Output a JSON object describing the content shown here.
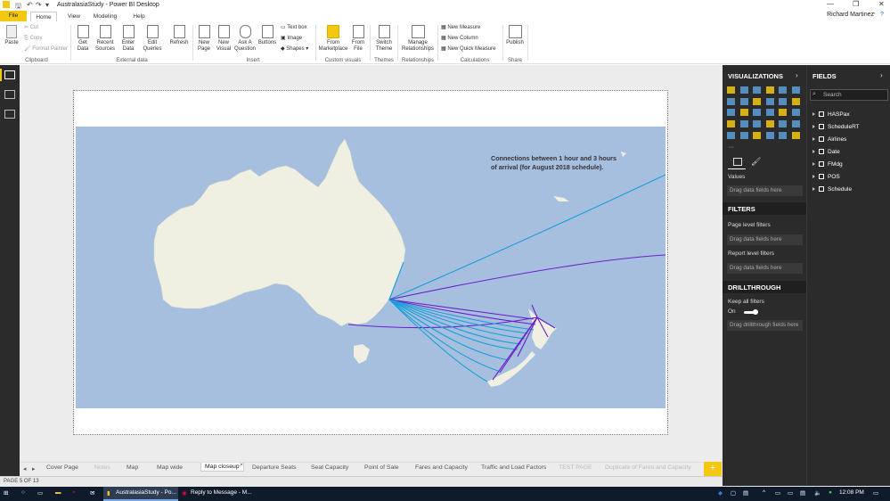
{
  "app": {
    "title": "AustralasiaStudy - Power BI Desktop",
    "user": "Richard Martinez"
  },
  "tabs": [
    "File",
    "Home",
    "View",
    "Modeling",
    "Help"
  ],
  "ribbon": {
    "clipboard": {
      "paste": "Paste",
      "cut": "Cut",
      "copy": "Copy",
      "format_painter": "Format Painter",
      "group": "Clipboard"
    },
    "external": {
      "get_data": "Get Data",
      "recent_sources": "Recent Sources",
      "enter_data": "Enter Data",
      "edit_queries": "Edit Queries",
      "refresh": "Refresh",
      "group": "External data"
    },
    "insert": {
      "new_page": "New Page",
      "new_visual": "New Visual",
      "ask": "Ask A Question",
      "buttons": "Buttons",
      "text_box": "Text box",
      "image": "Image",
      "shapes": "Shapes",
      "group": "Insert"
    },
    "custom": {
      "marketplace": "From Marketplace",
      "file": "From File",
      "group": "Custom visuals"
    },
    "themes": {
      "switch": "Switch Theme",
      "group": "Themes"
    },
    "relationships": {
      "manage": "Manage Relationships",
      "group": "Relationships"
    },
    "calculations": {
      "new_measure": "New Measure",
      "new_column": "New Column",
      "quick_measure": "New Quick Measure",
      "group": "Calculations"
    },
    "share": {
      "publish": "Publish",
      "group": "Share"
    }
  },
  "map": {
    "annotation_line1": "Connections between 1 hour and 3 hours",
    "annotation_line2": "of arrival (for August 2018 schedule).",
    "colors": {
      "ocean": "#a7bfdf",
      "land": "#efefe2",
      "route_a": "#1a9fd8",
      "route_b": "#6a1fc9"
    }
  },
  "page_tabs": [
    {
      "label": "Cover Page",
      "state": "normal"
    },
    {
      "label": "Notes",
      "state": "disabled"
    },
    {
      "label": "Map",
      "state": "normal"
    },
    {
      "label": "Map wide",
      "state": "normal"
    },
    {
      "label": "Map closeup",
      "state": "active"
    },
    {
      "label": "Departure Seats",
      "state": "normal"
    },
    {
      "label": "Seat Capacity",
      "state": "normal"
    },
    {
      "label": "Point of Sale",
      "state": "normal"
    },
    {
      "label": "Fares and Capacity",
      "state": "normal"
    },
    {
      "label": "Traffic and Load Factors",
      "state": "normal"
    },
    {
      "label": "TEST PAGE",
      "state": "disabled"
    },
    {
      "label": "Duplicate of Fares and Capacity",
      "state": "disabled"
    }
  ],
  "status": {
    "page": "PAGE 5 OF 13"
  },
  "visualizations": {
    "header": "VISUALIZATIONS",
    "values_label": "Values",
    "values_placeholder": "Drag data fields here",
    "filters_header": "FILTERS",
    "page_filters": "Page level filters",
    "page_filters_placeholder": "Drag data fields here",
    "report_filters": "Report level filters",
    "report_filters_placeholder": "Drag data fields here",
    "drill_header": "DRILLTHROUGH",
    "keep_filters": "Keep all filters",
    "toggle_state": "On",
    "drill_placeholder": "Drag drillthrough fields here"
  },
  "fields": {
    "header": "FIELDS",
    "search_placeholder": "Search",
    "items": [
      "HASPax",
      "ScheduleRT",
      "Airlines",
      "Date",
      "FMdg",
      "POS",
      "Schedule"
    ]
  },
  "taskbar": {
    "app1": "AustralasiaStudy - Po...",
    "app2": "Reply to Message - M...",
    "time": "12:08 PM"
  }
}
